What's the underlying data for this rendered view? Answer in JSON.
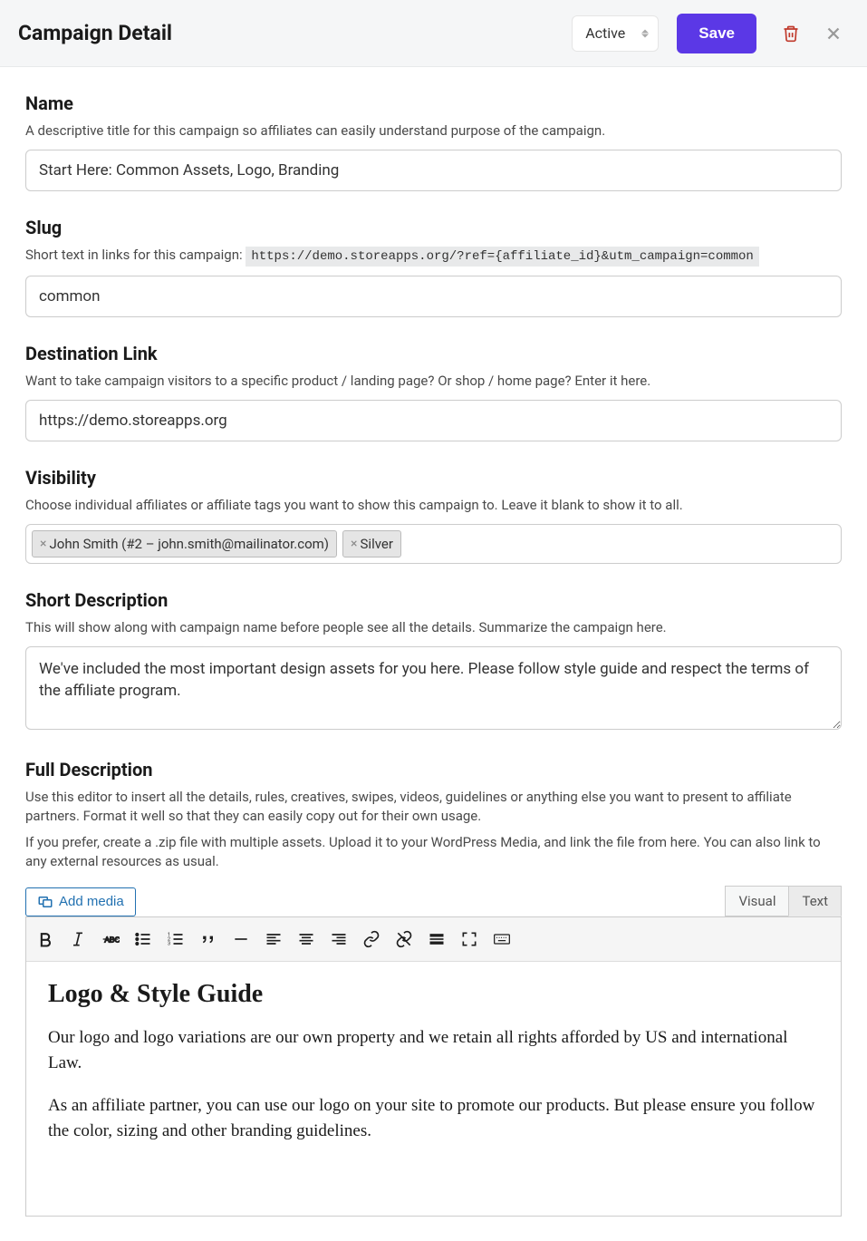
{
  "header": {
    "title": "Campaign Detail",
    "status_value": "Active",
    "save_label": "Save"
  },
  "name": {
    "label": "Name",
    "help": "A descriptive title for this campaign so affiliates can easily understand purpose of the campaign.",
    "value": "Start Here: Common Assets, Logo, Branding"
  },
  "slug": {
    "label": "Slug",
    "help_prefix": "Short text in links for this campaign: ",
    "help_code": "https://demo.storeapps.org/?ref={affiliate_id}&utm_campaign=common",
    "value": "common"
  },
  "destination": {
    "label": "Destination Link",
    "help": "Want to take campaign visitors to a specific product / landing page? Or shop / home page? Enter it here.",
    "value": "https://demo.storeapps.org"
  },
  "visibility": {
    "label": "Visibility",
    "help": "Choose individual affiliates or affiliate tags you want to show this campaign to. Leave it blank to show it to all.",
    "tags": [
      "John Smith (#2 – john.smith@mailinator.com)",
      "Silver"
    ]
  },
  "short_desc": {
    "label": "Short Description",
    "help": "This will show along with campaign name before people see all the details. Summarize the campaign here.",
    "value": "We've included the most important design assets for you here. Please follow style guide and respect the terms of the affiliate program."
  },
  "full_desc": {
    "label": "Full Description",
    "help1": "Use this editor to insert all the details, rules, creatives, swipes, videos, guidelines or anything else you want to present to affiliate partners. Format it well so that they can easily copy out for their own usage.",
    "help2": "If you prefer, create a .zip file with multiple assets. Upload it to your WordPress Media, and link the file from here. You can also link to any external resources as usual.",
    "add_media_label": "Add media",
    "tab_visual": "Visual",
    "tab_text": "Text",
    "body_heading": "Logo & Style Guide",
    "body_p1": "Our logo and logo variations are our own property and we retain all rights afforded by US and international Law.",
    "body_p2": "As an affiliate partner, you can use our logo on your site to promote our products. But please ensure you follow the color, sizing and other branding guidelines."
  }
}
